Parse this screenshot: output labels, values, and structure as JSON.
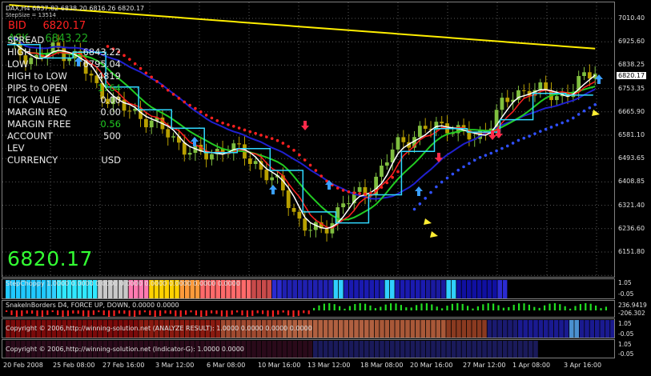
{
  "chart": {
    "symbol_line": "DAX,H4  6837.82 6838.20 6816.26 6820.17",
    "stepsize_line": "StepSize = 13514",
    "bid_label": "BID",
    "bid_value": "6820.17",
    "ask_label": "ASK",
    "ask_value": "6843.22",
    "current_price": "6820.17",
    "big_price": "6820.17"
  },
  "info_panel": [
    {
      "label": "SPREAD",
      "value": "",
      "green": false
    },
    {
      "label": "HIGH",
      "value": "6843.22",
      "green": false
    },
    {
      "label": "LOW",
      "value": "6795.04",
      "green": false
    },
    {
      "label": "HIGH to LOW",
      "value": "4819",
      "green": false
    },
    {
      "label": "PIPS to OPEN",
      "value": "1764",
      "green": true
    },
    {
      "label": "TICK VALUE",
      "value": "0.00",
      "green": false
    },
    {
      "label": "MARGIN REQ",
      "value": "0.00",
      "green": false
    },
    {
      "label": "MARGIN FREE",
      "value": "0.56",
      "green": true
    },
    {
      "label": "ACCOUNT LEV",
      "value": "500",
      "green": false
    },
    {
      "label": "CURRENCY",
      "value": "USD",
      "green": false
    }
  ],
  "price_axis": [
    "7010.40",
    "6925.60",
    "6838.25",
    "6753.35",
    "6665.90",
    "6581.10",
    "6493.65",
    "6408.85",
    "6321.40",
    "6236.60",
    "6151.80"
  ],
  "date_axis": [
    "20 Feb 2008",
    "25 Feb 08:00",
    "27 Feb 16:00",
    "3 Mar 12:00",
    "6 Mar 08:00",
    "10 Mar 16:00",
    "13 Mar 12:00",
    "18 Mar 08:00",
    "20 Mar 16:00",
    "27 Mar 12:00",
    "1 Apr 08:00",
    "3 Apr 16:00"
  ],
  "indicators": {
    "stoch_title": "StepChoppy 1.0000 0.0000 0.0000 0.0000 0.0000 0.0000 0.0000 0.0000",
    "stoch_scale": [
      "1.05",
      "-0.05"
    ],
    "snake_title": "SnakeInBorders D4, FORCE UP, DOWN, 0.0000 0.0000",
    "snake_scale": [
      "236.9419",
      "-206.302"
    ],
    "analyze_title": "Copyright © 2006,http://winning-solution.net (ANALYZE RESULT): 1.0000 0.0000 0.0000 0.0000",
    "analyze_scale": [
      "1.05",
      "-0.05"
    ],
    "indg_title": "Copyright © 2006,http://winning-solution.net (Indicator-G): 1.0000 0.0000",
    "indg_scale": [
      "1.05",
      "-0.05"
    ]
  },
  "colors": {
    "bull_candle": "#7fbf3f",
    "bear_candle": "#b8a000",
    "sma_slow": "#ffee00",
    "ma_blue": "#2020d0",
    "ma_green": "#22cc22",
    "ma_red": "#ff2020",
    "ma_white": "#ffffff",
    "ma_cyan": "#30d8ff",
    "dots_red": "#ff2020",
    "dots_blue": "#3050ff"
  }
}
